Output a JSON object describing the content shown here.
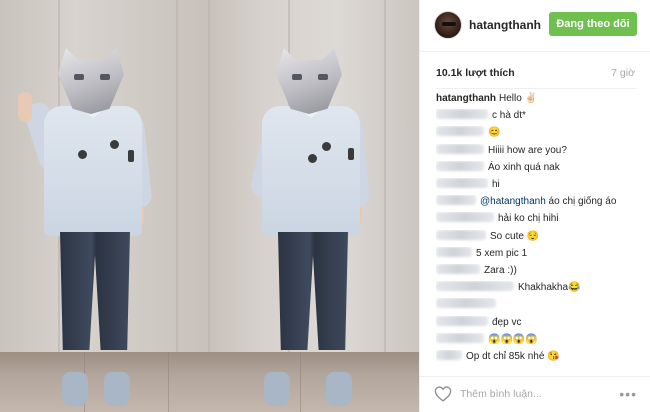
{
  "post": {
    "author": "hatangthanh",
    "follow_label": "Đang theo dõi",
    "likes": "10.1k lượt thích",
    "time": "7 giờ"
  },
  "comments": [
    {
      "user": "hatangthanh",
      "user_visible": true,
      "text": "Hello ✌🏻"
    },
    {
      "user": "",
      "user_visible": false,
      "prefix_blur": 52,
      "text": "c hà dt*"
    },
    {
      "user": "",
      "user_visible": false,
      "prefix_blur": 48,
      "text": "😊"
    },
    {
      "user": "",
      "user_visible": false,
      "prefix_blur": 48,
      "text": "Hiiii how are you?"
    },
    {
      "user": "",
      "user_visible": false,
      "prefix_blur": 48,
      "text": "Áo xinh quá nak"
    },
    {
      "user": "",
      "user_visible": false,
      "prefix_blur": 52,
      "text": "hi"
    },
    {
      "user": "",
      "user_visible": false,
      "prefix_blur": 40,
      "mention": "@hatangthanh",
      "text": "áo chị giống áo"
    },
    {
      "user": "",
      "user_visible": false,
      "prefix_blur": 58,
      "text": "hải ko chị hihi"
    },
    {
      "user": "",
      "user_visible": false,
      "prefix_blur": 50,
      "text": "So cute 😌"
    },
    {
      "user": "",
      "user_visible": false,
      "prefix_blur": 36,
      "text": "5 xem pic 1"
    },
    {
      "user": "",
      "user_visible": false,
      "prefix_blur": 44,
      "text": "Zara :))"
    },
    {
      "user": "",
      "user_visible": false,
      "prefix_blur": 78,
      "text": "Khakhakha😂"
    },
    {
      "user": "",
      "user_visible": false,
      "prefix_blur": 60,
      "text": ""
    },
    {
      "user": "",
      "user_visible": false,
      "prefix_blur": 52,
      "text": "đẹp vc"
    },
    {
      "user": "",
      "user_visible": false,
      "prefix_blur": 48,
      "text": "😱😱😱😱"
    },
    {
      "user": "",
      "user_visible": false,
      "prefix_blur": 26,
      "text": "Op dt chỉ 85k nhé 😘"
    }
  ],
  "footer": {
    "comment_placeholder": "Thêm bình luận...",
    "more_label": "•••"
  },
  "colors": {
    "follow_button": "#70c050",
    "mention": "#003569",
    "muted": "#a5a7aa"
  }
}
